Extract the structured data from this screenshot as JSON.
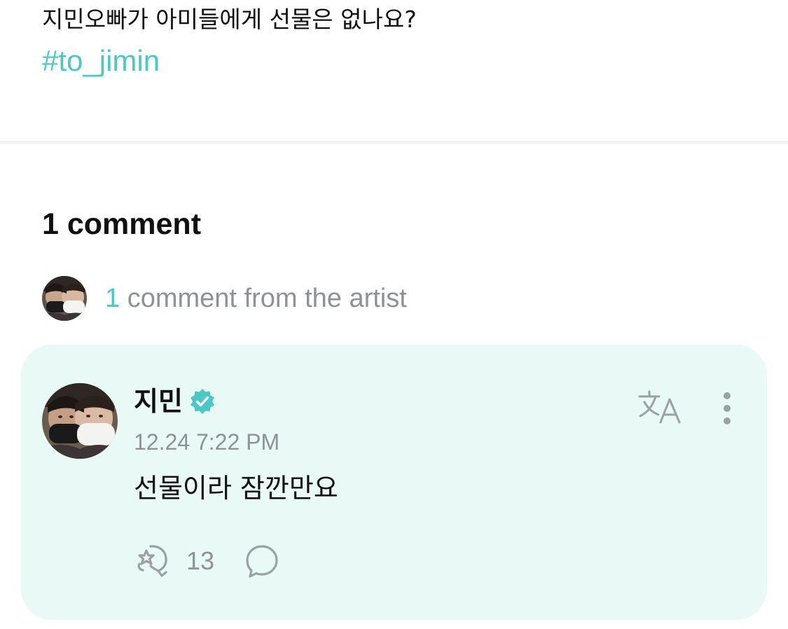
{
  "post": {
    "text": "지민오빠가 아미들에게 선물은 없나요?",
    "hashtag": "#to_jimin"
  },
  "comments_header": {
    "count_label": "1 comment"
  },
  "artist_summary": {
    "count": "1",
    "label": " comment from the artist"
  },
  "comment": {
    "author": "지민",
    "verified_icon": "verified-badge-icon",
    "timestamp": "12.24 7:22 PM",
    "text": "선물이라 잠깐만요",
    "like_count": "13",
    "icons": {
      "translate": "translate-icon",
      "more": "more-vertical-icon",
      "like": "like-icon",
      "reply": "reply-bubble-icon"
    }
  },
  "colors": {
    "accent": "#4cc8c4",
    "card_background": "#e9f9f6",
    "muted_text": "#8e9196"
  }
}
